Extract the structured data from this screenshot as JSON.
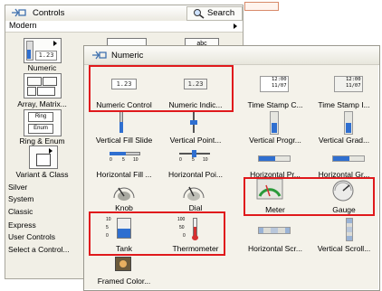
{
  "controls_palette": {
    "title": "Controls",
    "search_label": "Search",
    "modern_label": "Modern",
    "categories": [
      {
        "label": "Numeric"
      },
      {
        "label": "Array, Matrix..."
      },
      {
        "label": "Ring & Enum"
      },
      {
        "label": "Variant & Class"
      }
    ],
    "icon_texts": {
      "numeric_value": "1.23",
      "string_value": "abc",
      "ring": "Ring",
      "enum": "Enum"
    },
    "other_items": [
      "Silver",
      "System",
      "Classic",
      "Express",
      "User Controls",
      "Select a Control..."
    ]
  },
  "numeric_palette": {
    "title": "Numeric",
    "items": [
      {
        "label": "Numeric Control",
        "icon": "numeric-control-icon",
        "highlighted": true
      },
      {
        "label": "Numeric Indic...",
        "icon": "numeric-indicator-icon",
        "highlighted": true
      },
      {
        "label": "Time Stamp C...",
        "icon": "timestamp-control-icon",
        "highlighted": false
      },
      {
        "label": "Time Stamp I...",
        "icon": "timestamp-indicator-icon",
        "highlighted": false
      },
      {
        "label": "Vertical Fill Slide",
        "icon": "vertical-fill-slide-icon",
        "highlighted": false
      },
      {
        "label": "Vertical Point...",
        "icon": "vertical-pointer-slide-icon",
        "highlighted": false
      },
      {
        "label": "Vertical Progr...",
        "icon": "vertical-progress-bar-icon",
        "highlighted": false
      },
      {
        "label": "Vertical Grad...",
        "icon": "vertical-graduated-bar-icon",
        "highlighted": false
      },
      {
        "label": "Horizontal Fill ...",
        "icon": "horizontal-fill-slide-icon",
        "highlighted": false
      },
      {
        "label": "Horizontal Poi...",
        "icon": "horizontal-pointer-slide-icon",
        "highlighted": false
      },
      {
        "label": "Horizontal Pr...",
        "icon": "horizontal-progress-bar-icon",
        "highlighted": false
      },
      {
        "label": "Horizontal Gr...",
        "icon": "horizontal-graduated-bar-icon",
        "highlighted": false
      },
      {
        "label": "Knob",
        "icon": "knob-icon",
        "highlighted": false
      },
      {
        "label": "Dial",
        "icon": "dial-icon",
        "highlighted": false
      },
      {
        "label": "Meter",
        "icon": "meter-icon",
        "highlighted": true
      },
      {
        "label": "Gauge",
        "icon": "gauge-icon",
        "highlighted": true
      },
      {
        "label": "Tank",
        "icon": "tank-icon",
        "highlighted": true
      },
      {
        "label": "Thermometer",
        "icon": "thermometer-icon",
        "highlighted": true
      },
      {
        "label": "Horizontal Scr...",
        "icon": "horizontal-scrollbar-icon",
        "highlighted": false
      },
      {
        "label": "Vertical Scroll...",
        "icon": "vertical-scrollbar-icon",
        "highlighted": false
      },
      {
        "label": "Framed Color...",
        "icon": "framed-color-box-icon",
        "highlighted": false
      }
    ],
    "icon_texts": {
      "numeric_value": "1.23",
      "timestamp_time": "12:00",
      "timestamp_date": "11/07",
      "scale_low": "0",
      "scale_mid": "5",
      "scale_high": "10",
      "tank_top": "10",
      "tank_mid": "5",
      "tank_bottom": "0",
      "therm_top": "100",
      "therm_mid": "50",
      "therm_bottom": "0"
    }
  },
  "colors": {
    "highlight": "#e0191c",
    "fill_blue": "#2f6fd0",
    "fill_red": "#d43030"
  }
}
